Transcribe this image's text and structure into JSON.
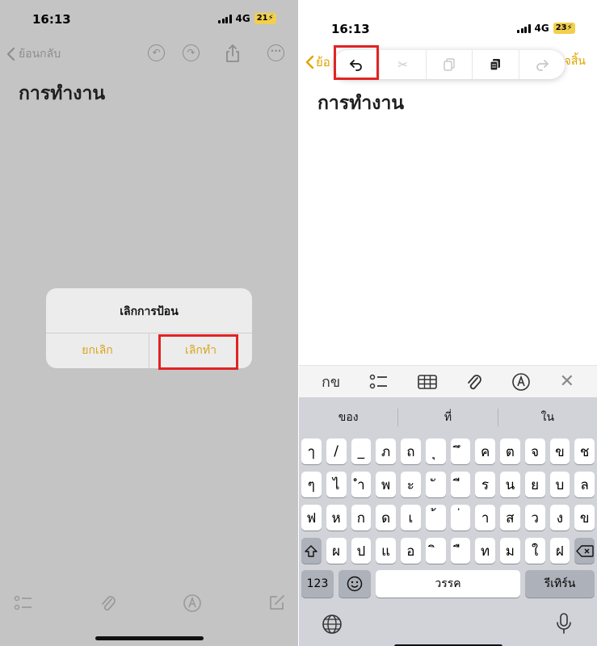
{
  "left": {
    "status": {
      "time": "16:13",
      "network": "4G",
      "battery": "21"
    },
    "nav": {
      "back_label": "ย้อนกลับ"
    },
    "note_title": "การทำงาน",
    "alert": {
      "title": "เลิกการป้อน",
      "cancel_label": "ยกเลิก",
      "undo_label": "เลิกทำ"
    }
  },
  "right": {
    "status": {
      "time": "16:13",
      "network": "4G",
      "battery": "23"
    },
    "nav": {
      "back_label": "ย้อ",
      "done_label": "จสิ้น"
    },
    "edit_menu": [
      "undo",
      "cut",
      "copy",
      "paste",
      "redo"
    ],
    "note_title": "การทำงาน",
    "format_bar": {
      "text_style_label": "กข"
    },
    "keyboard": {
      "predictions": [
        "ของ",
        "ที่",
        "ใน"
      ],
      "rows": [
        [
          "ๅ",
          "/",
          "_",
          "ภ",
          "ถ",
          "ุ",
          "ึ",
          "ค",
          "ต",
          "จ",
          "ข",
          "ช"
        ],
        [
          "ๆ",
          "ไ",
          "ำ",
          "พ",
          "ะ",
          "ั",
          "ี",
          "ร",
          "น",
          "ย",
          "บ",
          "ล"
        ],
        [
          "ฟ",
          "ห",
          "ก",
          "ด",
          "เ",
          "้",
          "่",
          "า",
          "ส",
          "ว",
          "ง",
          "ข"
        ],
        [
          "ผ",
          "ป",
          "แ",
          "อ",
          "ิ",
          "ื",
          "ท",
          "ม",
          "ใ",
          "ฝ"
        ]
      ],
      "numbers_label": "123",
      "space_label": "วรรค",
      "return_label": "รีเทิร์น"
    }
  },
  "colors": {
    "accent": "#e0a500",
    "highlight": "#e02424",
    "dim_background": "#c4c4c4"
  }
}
